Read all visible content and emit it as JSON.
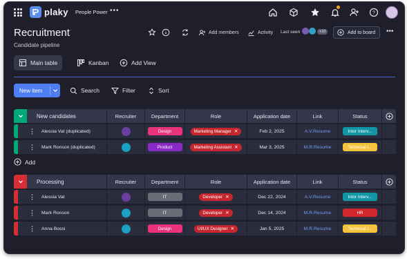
{
  "app": {
    "logo_text": "plaky",
    "workspace": "People Power",
    "more_glyph": "•••"
  },
  "board": {
    "title": "Recruitment",
    "subtitle": "Candidate pipeline",
    "add_members_label": "Add members",
    "activity_label": "Activity",
    "last_seen_label": "Last seen",
    "last_seen_more": "+10",
    "add_to_board_label": "Add to board"
  },
  "views": {
    "tabs": [
      {
        "label": "Main table",
        "icon": "table-icon",
        "active": true
      },
      {
        "label": "Kanban",
        "icon": "kanban-icon",
        "active": false
      }
    ],
    "add_view_label": "Add View"
  },
  "toolbar": {
    "new_item_label": "New item",
    "search_label": "Search",
    "filter_label": "Filter",
    "sort_label": "Sort"
  },
  "columns": [
    "Recruiter",
    "Department",
    "Role",
    "Application date",
    "Link",
    "Status"
  ],
  "groups": [
    {
      "name": "New candidates",
      "color": "#00a877",
      "rows": [
        {
          "name": "Alessia Vat (duplicated)",
          "department": "Design",
          "dept_color": "#e8327a",
          "role": "Marketing Manager",
          "date": "Feb 2, 2025",
          "link": "A.V.Resume",
          "status": "Intor Interv...",
          "status_color": "#1196a6",
          "avatar": "#6b3fa0"
        },
        {
          "name": "Mark Ronson (duplicated)",
          "department": "Product",
          "dept_color": "#8a2bc8",
          "role": "Marketing Assistant",
          "date": "Mar 3, 2025",
          "link": "M.R.Resume",
          "status": "Technical I...",
          "status_color": "#f5c23b",
          "avatar": "#1aa0c2"
        }
      ]
    },
    {
      "name": "Processing",
      "color": "#d62e35",
      "rows": [
        {
          "name": "Alessia Vat",
          "department": "IT",
          "dept_color": "#6b6d76",
          "role": "Developer",
          "date": "Dec 22, 2024",
          "link": "A.V.Resume",
          "status": "Intor Interv...",
          "status_color": "#1196a6",
          "avatar": "#6b3fa0"
        },
        {
          "name": "Mark Ronson",
          "department": "IT",
          "dept_color": "#6b6d76",
          "role": "Developer",
          "date": "Dec 14, 2024",
          "link": "M.R.Resume",
          "status": "HR",
          "status_color": "#d0262c",
          "avatar": "#1aa0c2"
        },
        {
          "name": "Anna Bossi",
          "department": "Design",
          "dept_color": "#e8327a",
          "role": "UI/UX Designer",
          "date": "Jan 5, 2025",
          "link": "M.R.Resume",
          "status": "Technical I...",
          "status_color": "#f5c23b",
          "avatar": "#1aa0c2"
        }
      ]
    }
  ],
  "add_row_label": "Add"
}
